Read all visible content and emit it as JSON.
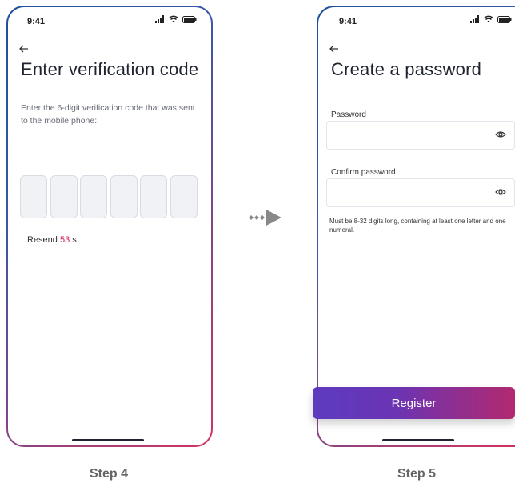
{
  "screen1": {
    "status_time": "9:41",
    "back_icon": "arrow-left",
    "title": "Enter verification code",
    "description": "Enter the 6-digit verification code that was sent to the mobile phone:",
    "resend_prefix": "Resend",
    "resend_count": "53",
    "resend_suffix": "s"
  },
  "screen2": {
    "status_time": "9:41",
    "back_icon": "arrow-left",
    "title": "Create a password",
    "password_label": "Password",
    "confirm_label": "Confirm password",
    "hint": "Must be 8-32 digits long, containing at least one letter and one numeral.",
    "register_label": "Register"
  },
  "steps": [
    "Step 4",
    "Step 5"
  ],
  "colors": {
    "accent": "#cc2553",
    "frame_start": "#1f4f9b",
    "frame_end": "#d2335f",
    "button_start": "#5d3bbf",
    "button_end": "#b2296f"
  }
}
